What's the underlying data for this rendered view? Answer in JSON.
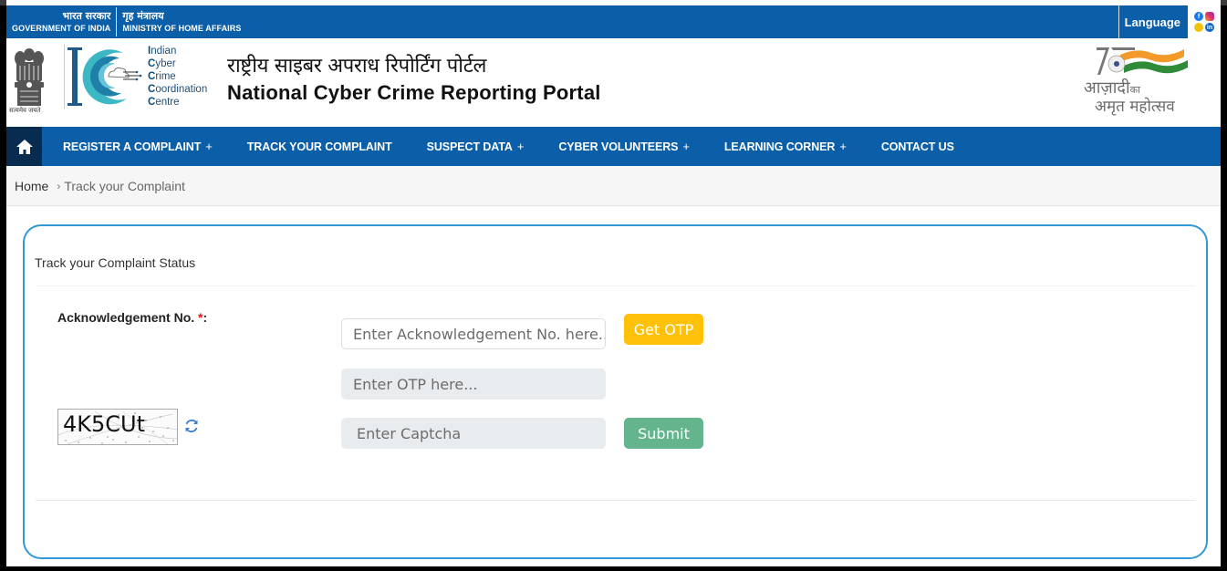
{
  "gov_bar": {
    "gov_hindi": "भारत सरकार",
    "gov_english": "GOVERNMENT OF INDIA",
    "ministry_hindi": "गृह मंत्रालय",
    "ministry_english": "MINISTRY OF HOME AFFAIRS",
    "language_label": "Language",
    "social": [
      {
        "name": "facebook",
        "glyph": "f"
      },
      {
        "name": "instagram",
        "glyph": "◎"
      },
      {
        "name": "koo",
        "glyph": ""
      },
      {
        "name": "linkedin",
        "glyph": "in"
      }
    ]
  },
  "header": {
    "emblem_caption": "सत्यमेव जयते",
    "i4c_lines": [
      {
        "initial": "I",
        "rest": "ndian"
      },
      {
        "initial": "C",
        "rest": "yber"
      },
      {
        "initial": "C",
        "rest": "rime"
      },
      {
        "initial": "C",
        "rest": "oordination"
      },
      {
        "initial": "C",
        "rest": "entre"
      }
    ],
    "title_hindi": "राष्ट्रीय साइबर अपराध रिपोर्टिंग पोर्टल",
    "title_english": "National Cyber Crime Reporting Portal",
    "azadi_line1": "आज़ादी",
    "azadi_ka": "का",
    "azadi_line2": "अमृत महोत्सव",
    "azadi_number": "75"
  },
  "nav": {
    "home_icon": "home-icon",
    "items": [
      {
        "label": "REGISTER A COMPLAINT",
        "has_submenu": true
      },
      {
        "label": "TRACK YOUR COMPLAINT",
        "has_submenu": false
      },
      {
        "label": "SUSPECT DATA",
        "has_submenu": true
      },
      {
        "label": "CYBER VOLUNTEERS",
        "has_submenu": true
      },
      {
        "label": "LEARNING CORNER",
        "has_submenu": true
      },
      {
        "label": "CONTACT US",
        "has_submenu": false
      }
    ],
    "submenu_glyph": "+"
  },
  "breadcrumb": {
    "home": "Home",
    "separator": "›",
    "current": "Track your Complaint"
  },
  "form": {
    "title": "Track your Complaint Status",
    "ack_label": "Acknowledgement No.",
    "required_mark": "*",
    "label_suffix": ":",
    "ack_placeholder": "Enter Acknowledgement No. here...",
    "ack_value": "",
    "otp_placeholder": "Enter OTP here...",
    "otp_value": "",
    "captcha_text": "4K5CUt",
    "captcha_placeholder": "Enter Captcha",
    "captcha_value": "",
    "get_otp_label": "Get OTP",
    "submit_label": "Submit"
  },
  "colors": {
    "primary_blue": "#0b5ea8",
    "home_dark": "#072c4f",
    "card_border": "#3298d6",
    "otp_button": "#ffc107",
    "submit_button": "#64b48e",
    "required": "#ee1111"
  }
}
